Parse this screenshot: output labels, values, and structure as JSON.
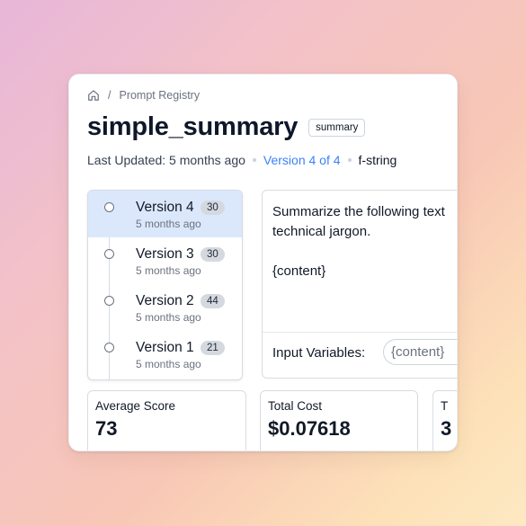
{
  "breadcrumb": {
    "home_icon": "home-icon",
    "separator": "/",
    "current": "Prompt Registry"
  },
  "prompt": {
    "name": "simple_summary",
    "tag": "summary",
    "last_updated": "Last Updated: 5 months ago",
    "version_indicator": "Version 4 of 4",
    "format": "f-string",
    "text": "Summarize the following text\ntechnical jargon.\n\n{content}",
    "input_variables_label": "Input Variables:",
    "input_variables": [
      "{content}"
    ]
  },
  "versions": [
    {
      "label": "Version 4",
      "count": "30",
      "time": "5 months ago",
      "active": true
    },
    {
      "label": "Version 3",
      "count": "30",
      "time": "5 months ago",
      "active": false
    },
    {
      "label": "Version 2",
      "count": "44",
      "time": "5 months ago",
      "active": false
    },
    {
      "label": "Version 1",
      "count": "21",
      "time": "5 months ago",
      "active": false
    }
  ],
  "stats": [
    {
      "label": "Average Score",
      "value": "73"
    },
    {
      "label": "Total Cost",
      "value": "$0.07618"
    },
    {
      "label": "T",
      "value": "3"
    }
  ],
  "colors": {
    "accent": "#3b82f6",
    "active_row": "#dbe8fb",
    "badge": "#d5d9df"
  }
}
